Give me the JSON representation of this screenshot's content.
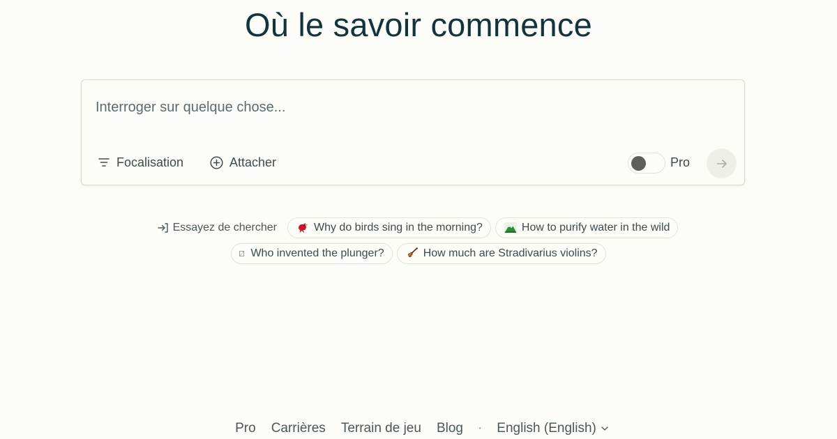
{
  "hero": {
    "title": "Où le savoir commence"
  },
  "search": {
    "placeholder": "Interroger sur quelque chose...",
    "value": "",
    "focus_label": "Focalisation",
    "attach_label": "Attacher",
    "pro_label": "Pro",
    "pro_enabled": false,
    "submit_icon": "arrow-right-icon"
  },
  "suggestions": {
    "try_label": "Essayez de chercher",
    "items": [
      {
        "emoji": "bird-icon",
        "label": "Why do birds sing in the morning?"
      },
      {
        "emoji": "mountain-icon",
        "label": "How to purify water in the wild"
      },
      {
        "emoji": "unknown-glyph-icon",
        "label": "Who invented the plunger?"
      },
      {
        "emoji": "violin-icon",
        "label": "How much are Stradivarius violins?"
      }
    ]
  },
  "footer": {
    "links": [
      "Pro",
      "Carrières",
      "Terrain de jeu",
      "Blog"
    ],
    "separator": "·",
    "language": "English (English)"
  },
  "colors": {
    "background": "#fcfcf8",
    "title": "#13343b",
    "border": "#d9dad4",
    "text_secondary": "#4a585b"
  }
}
